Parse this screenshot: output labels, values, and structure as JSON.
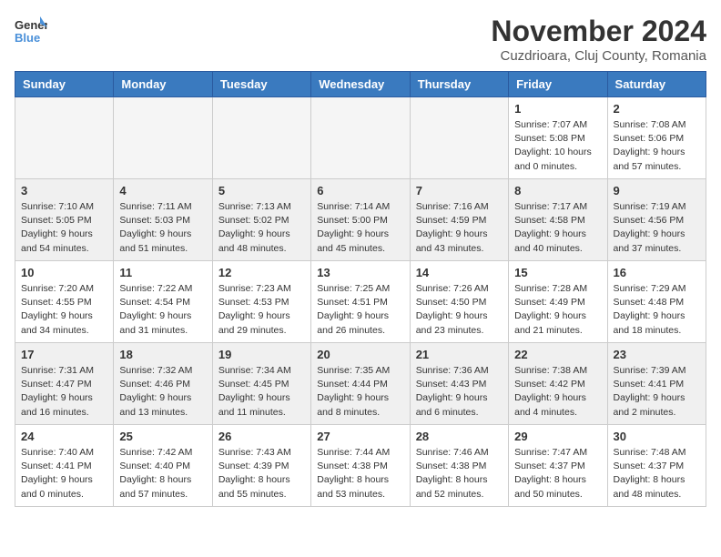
{
  "logo": {
    "general": "General",
    "blue": "Blue"
  },
  "title": "November 2024",
  "location": "Cuzdrioara, Cluj County, Romania",
  "days_of_week": [
    "Sunday",
    "Monday",
    "Tuesday",
    "Wednesday",
    "Thursday",
    "Friday",
    "Saturday"
  ],
  "weeks": [
    {
      "days": [
        {
          "num": "",
          "empty": true
        },
        {
          "num": "",
          "empty": true
        },
        {
          "num": "",
          "empty": true
        },
        {
          "num": "",
          "empty": true
        },
        {
          "num": "",
          "empty": true
        },
        {
          "num": "1",
          "sunrise": "Sunrise: 7:07 AM",
          "sunset": "Sunset: 5:08 PM",
          "daylight": "Daylight: 10 hours and 0 minutes."
        },
        {
          "num": "2",
          "sunrise": "Sunrise: 7:08 AM",
          "sunset": "Sunset: 5:06 PM",
          "daylight": "Daylight: 9 hours and 57 minutes."
        }
      ]
    },
    {
      "days": [
        {
          "num": "3",
          "sunrise": "Sunrise: 7:10 AM",
          "sunset": "Sunset: 5:05 PM",
          "daylight": "Daylight: 9 hours and 54 minutes."
        },
        {
          "num": "4",
          "sunrise": "Sunrise: 7:11 AM",
          "sunset": "Sunset: 5:03 PM",
          "daylight": "Daylight: 9 hours and 51 minutes."
        },
        {
          "num": "5",
          "sunrise": "Sunrise: 7:13 AM",
          "sunset": "Sunset: 5:02 PM",
          "daylight": "Daylight: 9 hours and 48 minutes."
        },
        {
          "num": "6",
          "sunrise": "Sunrise: 7:14 AM",
          "sunset": "Sunset: 5:00 PM",
          "daylight": "Daylight: 9 hours and 45 minutes."
        },
        {
          "num": "7",
          "sunrise": "Sunrise: 7:16 AM",
          "sunset": "Sunset: 4:59 PM",
          "daylight": "Daylight: 9 hours and 43 minutes."
        },
        {
          "num": "8",
          "sunrise": "Sunrise: 7:17 AM",
          "sunset": "Sunset: 4:58 PM",
          "daylight": "Daylight: 9 hours and 40 minutes."
        },
        {
          "num": "9",
          "sunrise": "Sunrise: 7:19 AM",
          "sunset": "Sunset: 4:56 PM",
          "daylight": "Daylight: 9 hours and 37 minutes."
        }
      ]
    },
    {
      "days": [
        {
          "num": "10",
          "sunrise": "Sunrise: 7:20 AM",
          "sunset": "Sunset: 4:55 PM",
          "daylight": "Daylight: 9 hours and 34 minutes."
        },
        {
          "num": "11",
          "sunrise": "Sunrise: 7:22 AM",
          "sunset": "Sunset: 4:54 PM",
          "daylight": "Daylight: 9 hours and 31 minutes."
        },
        {
          "num": "12",
          "sunrise": "Sunrise: 7:23 AM",
          "sunset": "Sunset: 4:53 PM",
          "daylight": "Daylight: 9 hours and 29 minutes."
        },
        {
          "num": "13",
          "sunrise": "Sunrise: 7:25 AM",
          "sunset": "Sunset: 4:51 PM",
          "daylight": "Daylight: 9 hours and 26 minutes."
        },
        {
          "num": "14",
          "sunrise": "Sunrise: 7:26 AM",
          "sunset": "Sunset: 4:50 PM",
          "daylight": "Daylight: 9 hours and 23 minutes."
        },
        {
          "num": "15",
          "sunrise": "Sunrise: 7:28 AM",
          "sunset": "Sunset: 4:49 PM",
          "daylight": "Daylight: 9 hours and 21 minutes."
        },
        {
          "num": "16",
          "sunrise": "Sunrise: 7:29 AM",
          "sunset": "Sunset: 4:48 PM",
          "daylight": "Daylight: 9 hours and 18 minutes."
        }
      ]
    },
    {
      "days": [
        {
          "num": "17",
          "sunrise": "Sunrise: 7:31 AM",
          "sunset": "Sunset: 4:47 PM",
          "daylight": "Daylight: 9 hours and 16 minutes."
        },
        {
          "num": "18",
          "sunrise": "Sunrise: 7:32 AM",
          "sunset": "Sunset: 4:46 PM",
          "daylight": "Daylight: 9 hours and 13 minutes."
        },
        {
          "num": "19",
          "sunrise": "Sunrise: 7:34 AM",
          "sunset": "Sunset: 4:45 PM",
          "daylight": "Daylight: 9 hours and 11 minutes."
        },
        {
          "num": "20",
          "sunrise": "Sunrise: 7:35 AM",
          "sunset": "Sunset: 4:44 PM",
          "daylight": "Daylight: 9 hours and 8 minutes."
        },
        {
          "num": "21",
          "sunrise": "Sunrise: 7:36 AM",
          "sunset": "Sunset: 4:43 PM",
          "daylight": "Daylight: 9 hours and 6 minutes."
        },
        {
          "num": "22",
          "sunrise": "Sunrise: 7:38 AM",
          "sunset": "Sunset: 4:42 PM",
          "daylight": "Daylight: 9 hours and 4 minutes."
        },
        {
          "num": "23",
          "sunrise": "Sunrise: 7:39 AM",
          "sunset": "Sunset: 4:41 PM",
          "daylight": "Daylight: 9 hours and 2 minutes."
        }
      ]
    },
    {
      "days": [
        {
          "num": "24",
          "sunrise": "Sunrise: 7:40 AM",
          "sunset": "Sunset: 4:41 PM",
          "daylight": "Daylight: 9 hours and 0 minutes."
        },
        {
          "num": "25",
          "sunrise": "Sunrise: 7:42 AM",
          "sunset": "Sunset: 4:40 PM",
          "daylight": "Daylight: 8 hours and 57 minutes."
        },
        {
          "num": "26",
          "sunrise": "Sunrise: 7:43 AM",
          "sunset": "Sunset: 4:39 PM",
          "daylight": "Daylight: 8 hours and 55 minutes."
        },
        {
          "num": "27",
          "sunrise": "Sunrise: 7:44 AM",
          "sunset": "Sunset: 4:38 PM",
          "daylight": "Daylight: 8 hours and 53 minutes."
        },
        {
          "num": "28",
          "sunrise": "Sunrise: 7:46 AM",
          "sunset": "Sunset: 4:38 PM",
          "daylight": "Daylight: 8 hours and 52 minutes."
        },
        {
          "num": "29",
          "sunrise": "Sunrise: 7:47 AM",
          "sunset": "Sunset: 4:37 PM",
          "daylight": "Daylight: 8 hours and 50 minutes."
        },
        {
          "num": "30",
          "sunrise": "Sunrise: 7:48 AM",
          "sunset": "Sunset: 4:37 PM",
          "daylight": "Daylight: 8 hours and 48 minutes."
        }
      ]
    }
  ]
}
